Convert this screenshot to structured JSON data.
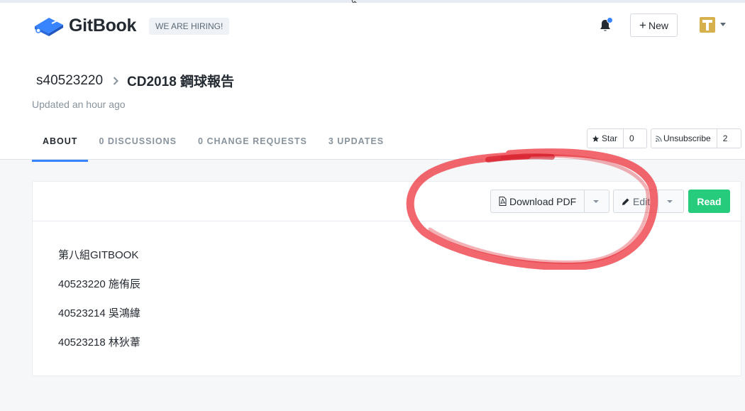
{
  "header": {
    "brand": "GitBook",
    "hiring_badge": "WE ARE HIRING!",
    "new_button": "New"
  },
  "breadcrumb": {
    "user": "s40523220",
    "separator": "›",
    "title": "CD2018 鋼球報告"
  },
  "updated": "Updated an hour ago",
  "tabs": [
    {
      "label": "ABOUT",
      "active": true
    },
    {
      "label": "0 DISCUSSIONS",
      "active": false
    },
    {
      "label": "0 CHANGE REQUESTS",
      "active": false
    },
    {
      "label": "3 UPDATES",
      "active": false
    }
  ],
  "star": {
    "label": "Star",
    "count": "0"
  },
  "subscribe": {
    "label": "Unsubscribe",
    "count": "2"
  },
  "toolbar": {
    "download_pdf": "Download PDF",
    "edit": "Edit",
    "read": "Read"
  },
  "content": {
    "lines": [
      "第八組GITBOOK",
      "40523220 施侑辰",
      "40523214 吳鴻緯",
      "40523218 林狄葦"
    ]
  },
  "colors": {
    "accent": "#3884ff",
    "read_button": "#26cb7c",
    "annotation": "#ee3b44"
  },
  "icons": {
    "logo": "book-icon",
    "bell": "bell-icon",
    "star": "star-icon",
    "rss": "rss-icon",
    "pdf": "pdf-file-icon",
    "edit": "pencil-icon"
  }
}
